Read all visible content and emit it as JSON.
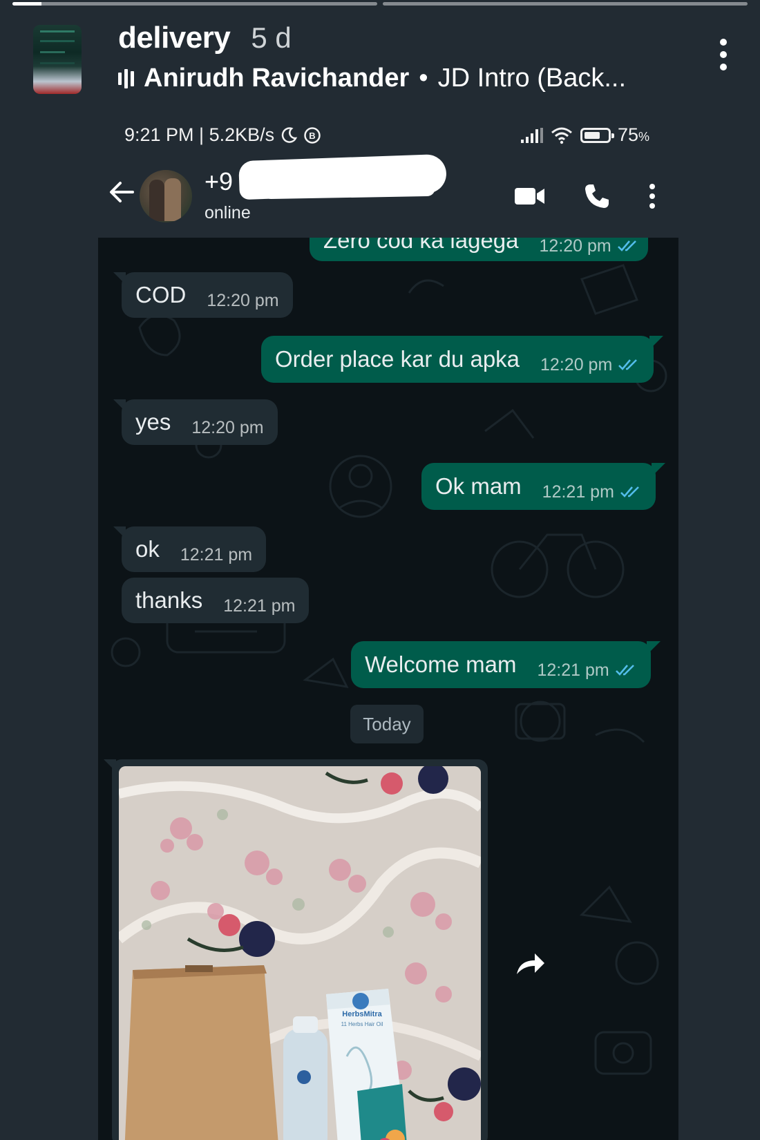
{
  "story": {
    "progress": [
      0.08,
      0
    ],
    "title": "delivery",
    "age": "5 d",
    "music_artist": "Anirudh Ravichander",
    "music_separator": "•",
    "music_track": "JD Intro (Back..."
  },
  "status_bar": {
    "left": "9:21 PM | 5.2KB/s",
    "battery": "75",
    "battery_suffix": "%",
    "battery_level": 0.75
  },
  "chat_header": {
    "number_prefix": "+9",
    "status": "online"
  },
  "messages": [
    {
      "dir": "out",
      "text": "Zero cod ka lagega",
      "time": "12:20 pm",
      "ticks": "read"
    },
    {
      "dir": "in",
      "text": "COD",
      "time": "12:20 pm"
    },
    {
      "dir": "out",
      "text": "Order place kar du apka",
      "time": "12:20 pm",
      "ticks": "read"
    },
    {
      "dir": "in",
      "text": "yes",
      "time": "12:20 pm"
    },
    {
      "dir": "out",
      "text": "Ok mam",
      "time": "12:21 pm",
      "ticks": "read"
    },
    {
      "dir": "in",
      "text": "ok",
      "time": "12:21 pm"
    },
    {
      "dir": "in",
      "text": "thanks",
      "time": "12:21 pm"
    },
    {
      "dir": "out",
      "text": "Welcome mam",
      "time": "12:21 pm",
      "ticks": "read"
    }
  ],
  "date_chip": "Today",
  "image_message": {
    "product_brand": "HerbsMitra",
    "product_subtitle": "11 Herbs Hair Oil"
  },
  "colors": {
    "outgoing_bubble": "#005c4b",
    "incoming_bubble": "#202c33",
    "chat_background": "#0c1317",
    "read_tick": "#53bdeb"
  }
}
